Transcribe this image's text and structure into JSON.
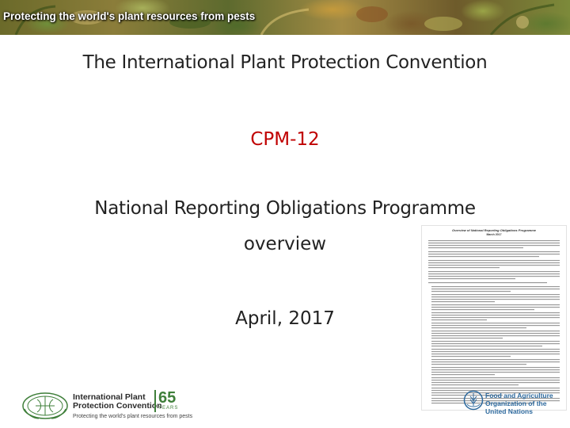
{
  "banner": {
    "title": "Protecting the world's plant resources from pests"
  },
  "slide": {
    "title": "The International Plant Protection Convention",
    "session": "CPM-12",
    "subtitle_line1": "National Reporting Obligations Programme",
    "subtitle_line2": "overview",
    "date": "April, 2017"
  },
  "document_thumbnail": {
    "heading": "Overview of National Reporting Obligations Programme",
    "date": "March 2017"
  },
  "footer": {
    "ippc": {
      "name_line1": "International Plant",
      "name_line2": "Protection Convention",
      "tagline": "Protecting the world's plant resources from pests",
      "anniversary_number": "65",
      "anniversary_label": "YEARS"
    },
    "fao": {
      "name_line1": "Food and Agriculture",
      "name_line2": "Organization of the",
      "name_line3": "United Nations"
    }
  },
  "colors": {
    "session_red": "#c00000",
    "ippc_green": "#3f7f3a",
    "fao_blue": "#2e6a9e"
  }
}
